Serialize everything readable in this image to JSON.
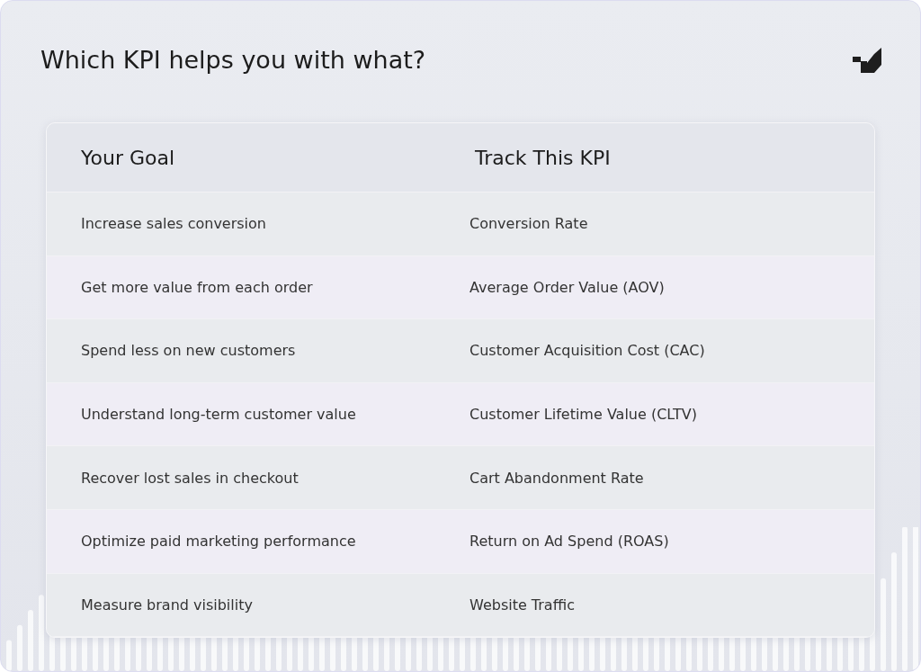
{
  "title": "Which KPI helps you with what?",
  "table": {
    "columns": [
      "Your Goal",
      "Track This KPI"
    ],
    "rows": [
      [
        "Increase sales conversion",
        "Conversion Rate"
      ],
      [
        "Get more value from each order",
        "Average Order Value (AOV)"
      ],
      [
        "Spend less on new customers",
        "Customer Acquisition Cost (CAC)"
      ],
      [
        "Understand long-term customer value",
        "Customer Lifetime Value (CLTV)"
      ],
      [
        "Recover lost sales in checkout",
        "Cart Abandonment Rate"
      ],
      [
        "Optimize paid marketing performance",
        "Return on Ad Spend (ROAS)"
      ],
      [
        "Measure brand visibility",
        "Website Traffic"
      ]
    ]
  }
}
